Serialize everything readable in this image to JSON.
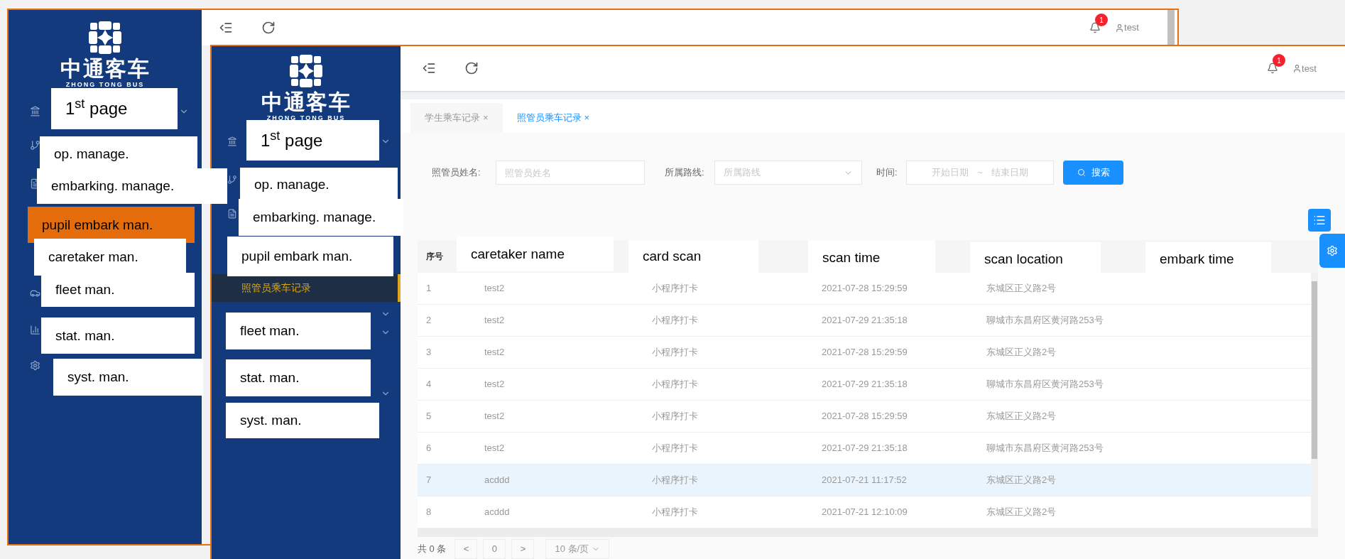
{
  "back_window": {
    "logo": {
      "name_cn": "中通客车",
      "name_en": "ZHONG TONG BUS"
    },
    "header": {
      "notification_count": "1",
      "user": "test"
    }
  },
  "front_window": {
    "logo": {
      "name_cn": "中通客车",
      "name_en": "ZHONG TONG BUS"
    },
    "sidebar": {
      "submenu_items": [
        {
          "label": "照管员乘车记录",
          "selected": true
        }
      ]
    },
    "header": {
      "notification_count": "1",
      "user": "test"
    },
    "tabs": [
      {
        "label": "学生乘车记录",
        "close": "×",
        "selected": false
      },
      {
        "label": "照管员乘车记录",
        "close": "×",
        "selected": true
      }
    ],
    "filters": {
      "name_label": "照管员姓名:",
      "name_placeholder": "照管员姓名",
      "route_label": "所属路线:",
      "route_placeholder": "所属路线",
      "time_label": "时间:",
      "start_placeholder": "开始日期",
      "range_separator": "~",
      "end_placeholder": "结束日期",
      "search_button": "搜索"
    },
    "table": {
      "columns": [
        "序号"
      ],
      "rows": [
        {
          "cells": [
            "1",
            "test2",
            "小程序打卡",
            "2021-07-28 15:29:59",
            "东城区正义路2号"
          ],
          "selected": false
        },
        {
          "cells": [
            "2",
            "test2",
            "小程序打卡",
            "2021-07-29 21:35:18",
            "聊城市东昌府区黄河路253号"
          ],
          "selected": false
        },
        {
          "cells": [
            "3",
            "test2",
            "小程序打卡",
            "2021-07-28 15:29:59",
            "东城区正义路2号"
          ],
          "selected": false
        },
        {
          "cells": [
            "4",
            "test2",
            "小程序打卡",
            "2021-07-29 21:35:18",
            "聊城市东昌府区黄河路253号"
          ],
          "selected": false
        },
        {
          "cells": [
            "5",
            "test2",
            "小程序打卡",
            "2021-07-28 15:29:59",
            "东城区正义路2号"
          ],
          "selected": false
        },
        {
          "cells": [
            "6",
            "test2",
            "小程序打卡",
            "2021-07-29 21:35:18",
            "聊城市东昌府区黄河路253号"
          ],
          "selected": false
        },
        {
          "cells": [
            "7",
            "acddd",
            "小程序打卡",
            "2021-07-21 11:17:52",
            "东城区正义路2号"
          ],
          "selected": true
        },
        {
          "cells": [
            "8",
            "acddd",
            "小程序打卡",
            "2021-07-21 12:10:09",
            "东城区正义路2号"
          ],
          "selected": false
        }
      ]
    },
    "pagination": {
      "total": "共 0 条",
      "prev": "<",
      "page": "0",
      "next": ">",
      "page_size": "10 条/页"
    }
  },
  "annotations": {
    "back_sidebar": [
      {
        "text": "1$^{st}$ page",
        "color": "#ffffff"
      },
      {
        "text": "op. manage.",
        "color": "#ffffff"
      },
      {
        "text": "embarking. manage.",
        "color": "#ffffff"
      },
      {
        "text": "pupil embark man.",
        "color": "#e46c0a"
      },
      {
        "text": "caretaker  man.",
        "color": "#ffffff"
      },
      {
        "text": "fleet man.",
        "color": "#ffffff"
      },
      {
        "text": "stat.  man.",
        "color": "#ffffff"
      },
      {
        "text": "syst.  man.",
        "color": "#ffffff"
      }
    ],
    "front_sidebar": [
      {
        "text": "1$^{st}$ page",
        "color": "#ffffff"
      },
      {
        "text": "op. manage.",
        "color": "#ffffff"
      },
      {
        "text": "embarking. manage.",
        "color": "#ffffff"
      },
      {
        "text": "pupil embark man.",
        "color": "#ffffff"
      },
      {
        "text": "fleet man.",
        "color": "#ffffff"
      },
      {
        "text": "stat.  man.",
        "color": "#ffffff"
      },
      {
        "text": "syst.  man.",
        "color": "#ffffff"
      }
    ],
    "table_headers": [
      {
        "text": "caretaker name",
        "color": "#ffffff"
      },
      {
        "text": "card scan",
        "color": "#ffffff"
      },
      {
        "text": "scan time",
        "color": "#ffffff"
      },
      {
        "text": "scan location",
        "color": "#ffffff"
      },
      {
        "text": "embark time",
        "color": "#ffffff"
      }
    ]
  }
}
